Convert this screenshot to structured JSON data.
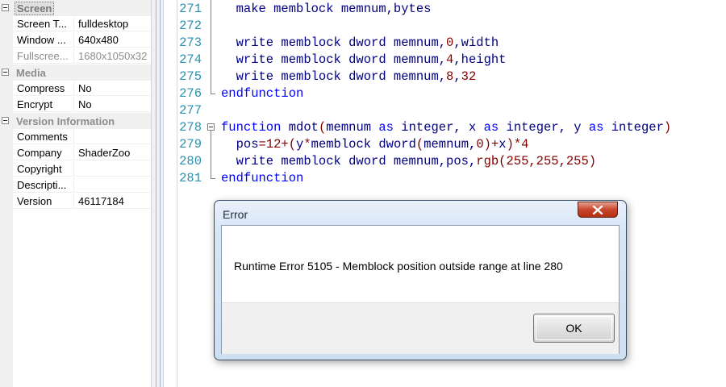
{
  "properties": {
    "categories": [
      {
        "name": "Screen",
        "rows": [
          {
            "name": "Screen T...",
            "value": "fulldesktop"
          },
          {
            "name": "Window ...",
            "value": "640x480"
          },
          {
            "name": "Fullscree...",
            "value": "1680x1050x32",
            "disabled": true
          }
        ]
      },
      {
        "name": "Media",
        "rows": [
          {
            "name": "Compress",
            "value": "No"
          },
          {
            "name": "Encrypt",
            "value": "No"
          }
        ]
      },
      {
        "name": "Version Information",
        "rows": [
          {
            "name": "Comments",
            "value": ""
          },
          {
            "name": "Company",
            "value": "ShaderZoo"
          },
          {
            "name": "Copyright",
            "value": ""
          },
          {
            "name": "Descripti...",
            "value": ""
          },
          {
            "name": "Version",
            "value": "46117184"
          }
        ]
      }
    ]
  },
  "editor": {
    "lines": [
      {
        "num": "271",
        "tokens": [
          {
            "t": "  make memblock memnum,bytes"
          }
        ]
      },
      {
        "num": "272",
        "tokens": []
      },
      {
        "num": "273",
        "tokens": [
          {
            "t": "  write memblock dword memnum,"
          },
          {
            "t": "0",
            "c": "n"
          },
          {
            "t": ",width"
          }
        ]
      },
      {
        "num": "274",
        "tokens": [
          {
            "t": "  write memblock dword memnum,"
          },
          {
            "t": "4",
            "c": "n"
          },
          {
            "t": ",height"
          }
        ]
      },
      {
        "num": "275",
        "tokens": [
          {
            "t": "  write memblock dword memnum,"
          },
          {
            "t": "8",
            "c": "n"
          },
          {
            "t": ","
          },
          {
            "t": "32",
            "c": "n"
          }
        ]
      },
      {
        "num": "276",
        "tokens": [
          {
            "t": "endfunction",
            "c": "k"
          }
        ]
      },
      {
        "num": "277",
        "tokens": []
      },
      {
        "num": "278",
        "tokens": [
          {
            "t": "function ",
            "c": "k"
          },
          {
            "t": "mdot"
          },
          {
            "t": "(",
            "c": "n"
          },
          {
            "t": "memnum "
          },
          {
            "t": "as",
            "c": "k"
          },
          {
            "t": " integer, x "
          },
          {
            "t": "as",
            "c": "k"
          },
          {
            "t": " integer, y "
          },
          {
            "t": "as",
            "c": "k"
          },
          {
            "t": " integer"
          },
          {
            "t": ")",
            "c": "n"
          }
        ]
      },
      {
        "num": "279",
        "tokens": [
          {
            "t": "  pos"
          },
          {
            "t": "=12+(",
            "c": "n"
          },
          {
            "t": "y"
          },
          {
            "t": "*",
            "c": "n"
          },
          {
            "t": "memblock dword"
          },
          {
            "t": "(",
            "c": "n"
          },
          {
            "t": "memnum,"
          },
          {
            "t": "0",
            "c": "n"
          },
          {
            "t": ")+",
            "c": "n"
          },
          {
            "t": "x"
          },
          {
            "t": ")*4",
            "c": "n"
          }
        ]
      },
      {
        "num": "280",
        "tokens": [
          {
            "t": "  write memblock dword memnum,pos,"
          },
          {
            "t": "rgb(255,255,255)",
            "c": "n"
          }
        ]
      },
      {
        "num": "281",
        "tokens": [
          {
            "t": "endfunction",
            "c": "k"
          }
        ]
      }
    ]
  },
  "dialog": {
    "title": "Error",
    "message": "Runtime Error 5105 - Memblock position outside range at line 280",
    "ok_label": "OK"
  }
}
